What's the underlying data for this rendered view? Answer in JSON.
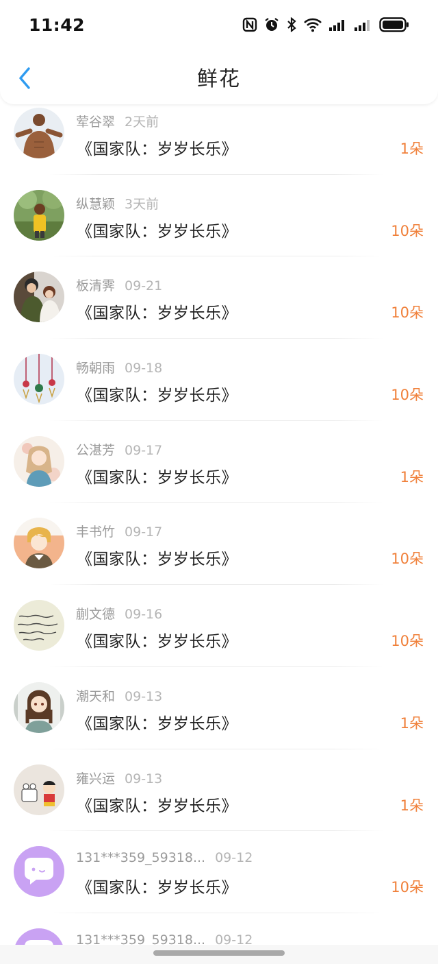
{
  "status_bar": {
    "time": "11:42"
  },
  "header": {
    "title": "鲜花"
  },
  "list": [
    {
      "name": "荤谷翠",
      "date": "2天前",
      "title": "《国家队：岁岁长乐》",
      "count": "1朵",
      "avatar": "person-photo"
    },
    {
      "name": "纵慧颖",
      "date": "3天前",
      "title": "《国家队：岁岁长乐》",
      "count": "10朵",
      "avatar": "child-photo"
    },
    {
      "name": "板清霁",
      "date": "09-21",
      "title": "《国家队：岁岁长乐》",
      "count": "10朵",
      "avatar": "couple-photo"
    },
    {
      "name": "畅朝雨",
      "date": "09-18",
      "title": "《国家队：岁岁长乐》",
      "count": "10朵",
      "avatar": "ornaments-photo"
    },
    {
      "name": "公湛芳",
      "date": "09-17",
      "title": "《国家队：岁岁长乐》",
      "count": "1朵",
      "avatar": "anime-girl-art"
    },
    {
      "name": "丰书竹",
      "date": "09-17",
      "title": "《国家队：岁岁长乐》",
      "count": "10朵",
      "avatar": "anime-boy-art"
    },
    {
      "name": "蒯文德",
      "date": "09-16",
      "title": "《国家队：岁岁长乐》",
      "count": "10朵",
      "avatar": "handwriting-image"
    },
    {
      "name": "潮天和",
      "date": "09-13",
      "title": "《国家队：岁岁长乐》",
      "count": "1朵",
      "avatar": "anime-girl-braids"
    },
    {
      "name": "雍兴运",
      "date": "09-13",
      "title": "《国家队：岁岁长乐》",
      "count": "1朵",
      "avatar": "cartoon-image"
    },
    {
      "name": "131***359_59318...",
      "date": "09-12",
      "title": "《国家队：岁岁长乐》",
      "count": "10朵",
      "avatar": "default-chat-avatar"
    },
    {
      "name": "131***359_59318...",
      "date": "09-12",
      "title": "",
      "count": "",
      "avatar": "default-chat-avatar"
    }
  ],
  "colors": {
    "accent_blue": "#2e9bf0",
    "count_orange": "#f0803a",
    "default_avatar_purple": "#c9a2f3"
  }
}
